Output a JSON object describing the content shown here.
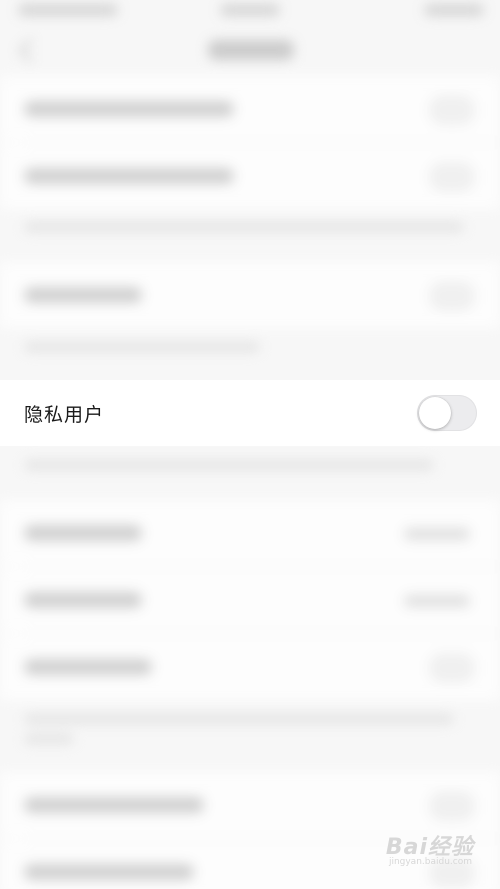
{
  "focused_setting": {
    "label": "隐私用户",
    "toggle_on": false
  },
  "watermark": {
    "brand": "Bai经验",
    "url": "jingyan.baidu.com"
  },
  "colors": {
    "background": "#f7f7f7",
    "row_background": "#ffffff",
    "switch_track_off": "#ececee",
    "label_text": "#1a1a1a"
  }
}
